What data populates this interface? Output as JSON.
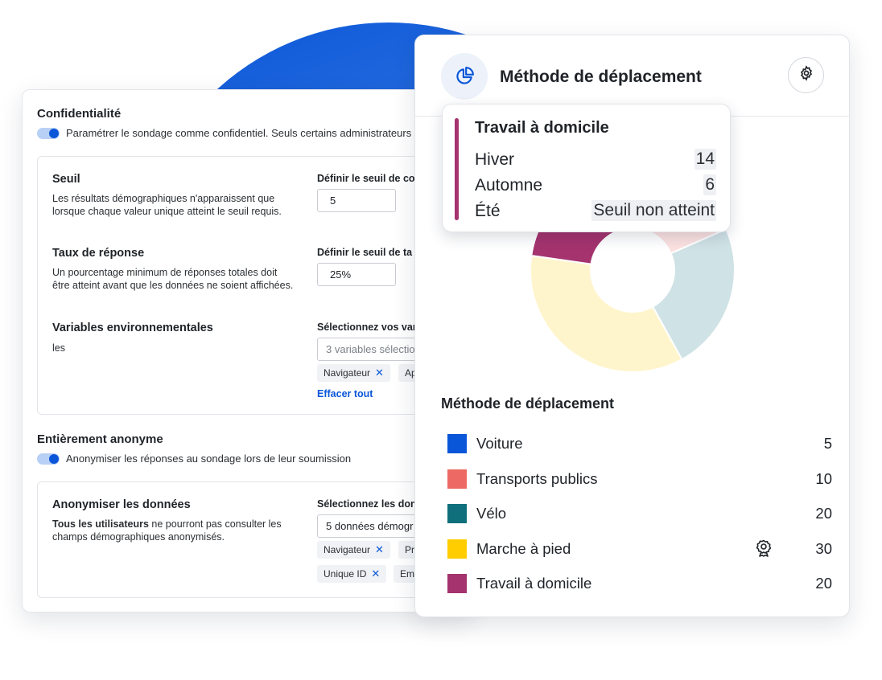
{
  "settings": {
    "confidentiality": {
      "title": "Confidentialité",
      "toggle_label": "Paramétrer le sondage comme confidentiel. Seuls certains administrateurs"
    },
    "threshold": {
      "title": "Seuil",
      "desc": "Les résultats démographiques n'apparaissent que lorsque chaque valeur unique atteint le seuil requis.",
      "right_label": "Définir le seuil de co",
      "value": "5"
    },
    "response_rate": {
      "title": "Taux de réponse",
      "desc": "Un pourcentage minimum de réponses totales doit être atteint avant que les données ne soient affichées.",
      "right_label": "Définir le seuil de ta",
      "value": "25%"
    },
    "env_vars": {
      "title": "Variables environnementales",
      "desc": "les",
      "right_label": "Sélectionnez vos var",
      "placeholder": "3 variables sélectio",
      "chips": [
        "Navigateur",
        "Ap"
      ],
      "clear_link": "Effacer tout"
    },
    "anonymous": {
      "title": "Entièrement anonyme",
      "toggle_label": "Anonymiser les réponses au sondage lors de leur soumission"
    },
    "anonymize_data": {
      "title": "Anonymiser les données",
      "desc_bold": "Tous les utilisateurs",
      "desc_rest": " ne pourront pas consulter les champs démographiques anonymisés.",
      "right_label": "Sélectionnez les don",
      "value": "5 données démogr",
      "chips_row1": [
        "Navigateur",
        "Pr"
      ],
      "chips_row2": [
        "Unique ID",
        "Em"
      ]
    }
  },
  "card": {
    "title": "Méthode de déplacement",
    "icon": "pie-chart-icon",
    "settings_icon": "gear-icon"
  },
  "tooltip": {
    "title": "Travail à domicile",
    "color": "#a4336e",
    "rows": [
      {
        "label": "Hiver",
        "value": "14"
      },
      {
        "label": "Automne",
        "value": "6"
      },
      {
        "label": "Été",
        "value": "Seuil non atteint"
      }
    ]
  },
  "chart_data": {
    "type": "pie",
    "title": "Méthode de déplacement",
    "categories": [
      "Voiture",
      "Transports publics",
      "Vélo",
      "Marche à pied",
      "Travail à domicile"
    ],
    "values": [
      5,
      10,
      20,
      30,
      20
    ],
    "colors": [
      "#0a56d8",
      "#ec6a63",
      "#0f6f7b",
      "#ffcd00",
      "#a4336e"
    ],
    "donut": true,
    "highlighted": "Travail à domicile",
    "badge_on": "Marche à pied",
    "badge_icon": "award-icon"
  }
}
